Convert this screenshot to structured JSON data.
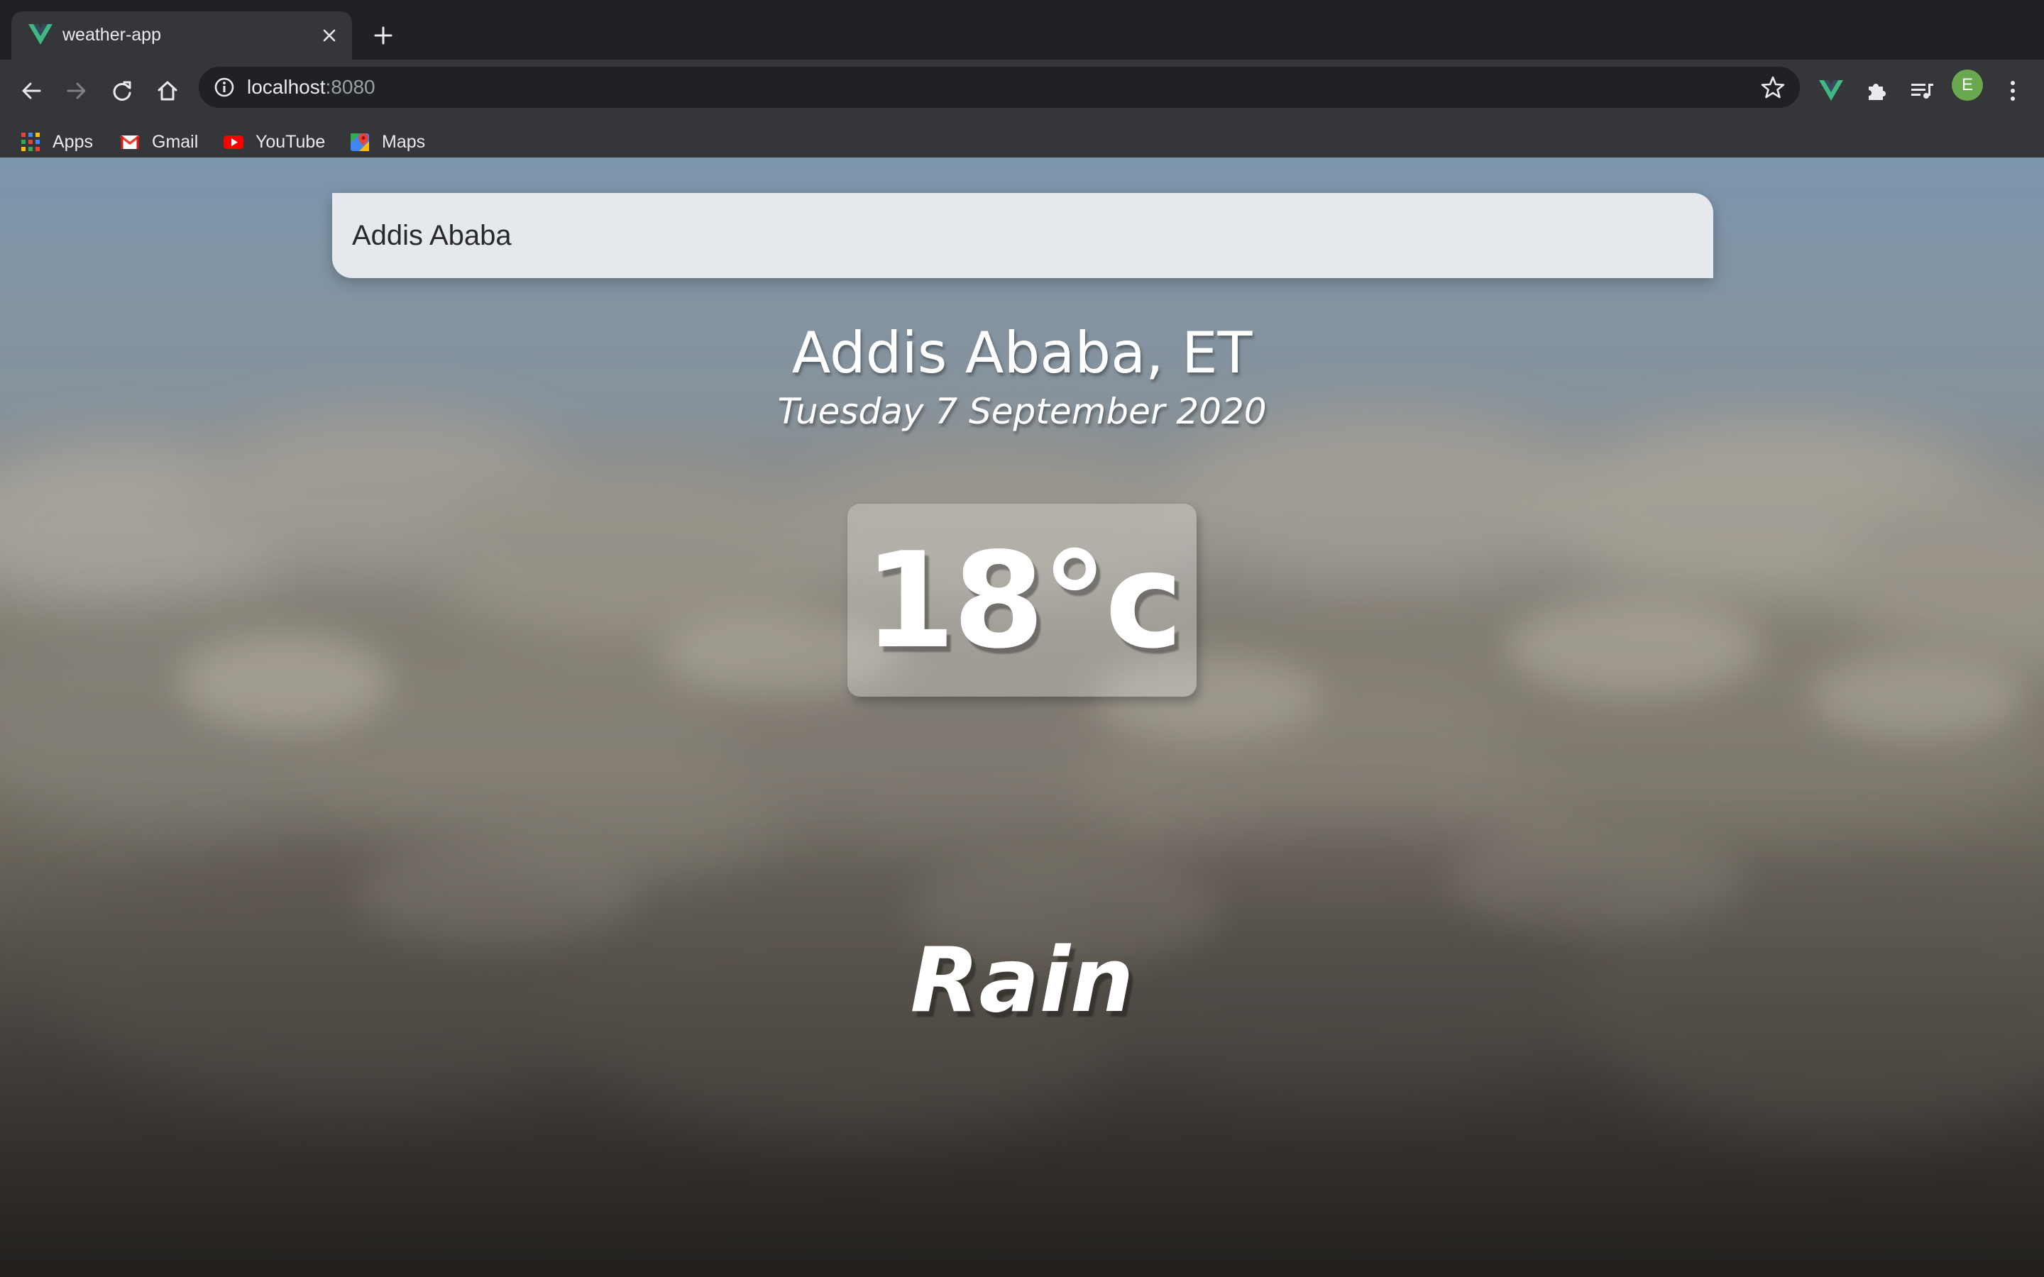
{
  "browser": {
    "tab": {
      "title": "weather-app",
      "favicon": "vue-logo-icon"
    },
    "address": {
      "host": "localhost",
      "port": ":8080"
    },
    "bookmarks": [
      {
        "label": "Apps",
        "icon": "apps-grid-icon"
      },
      {
        "label": "Gmail",
        "icon": "gmail-icon"
      },
      {
        "label": "YouTube",
        "icon": "youtube-icon"
      },
      {
        "label": "Maps",
        "icon": "maps-icon"
      }
    ],
    "profile_initial": "E",
    "colors": {
      "chrome_dark": "#202124",
      "chrome_toolbar": "#35363a",
      "vue_green": "#41b883",
      "avatar_green": "#6aa84f"
    }
  },
  "app": {
    "search": {
      "value": "Addis Ababa"
    },
    "location": "Addis Ababa, ET",
    "date": "Tuesday 7 September 2020",
    "temperature": "18°c",
    "condition": "Rain"
  }
}
